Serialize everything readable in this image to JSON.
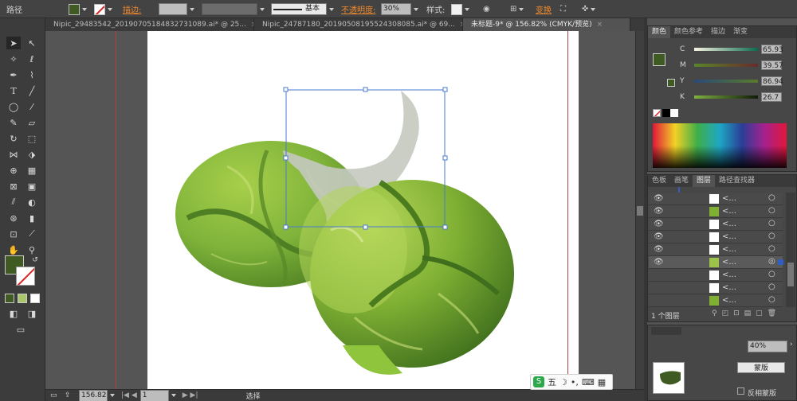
{
  "control_bar": {
    "mode_label": "路径",
    "stroke_label": "描边:",
    "stroke_style": "基本",
    "opacity_label": "不透明度:",
    "opacity_value": "30%",
    "style_label": "样式:",
    "transform_label": "变换"
  },
  "tabs": [
    {
      "label": "Nipic_29483542_20190705184832731089.ai* @ 25...",
      "active": false
    },
    {
      "label": "Nipic_24787180_20190508195524308085.ai* @ 69...",
      "active": false
    },
    {
      "label": "未标题-9* @ 156.82% (CMYK/预览)",
      "active": true
    }
  ],
  "color_panel": {
    "tabs": [
      "颜色",
      "颜色参考",
      "描边",
      "渐变"
    ],
    "channels": [
      {
        "name": "C",
        "value": "65.93"
      },
      {
        "name": "M",
        "value": "39.57"
      },
      {
        "name": "Y",
        "value": "86.94"
      },
      {
        "name": "K",
        "value": "26.7"
      }
    ]
  },
  "layers_panel": {
    "tabs": [
      "色板",
      "画笔",
      "图层",
      "路径查找器"
    ],
    "row_label": "<...",
    "footer": "1 个图层"
  },
  "transparency_panel": {
    "opacity_value": "40%",
    "mask_label": "蒙版",
    "invert_label": "反相蒙版"
  },
  "status": {
    "zoom": "156.82",
    "page": "1",
    "tool": "选择"
  },
  "ime": {
    "label": "五"
  },
  "colors": {
    "fill": "#3f5a22",
    "accent": "#f08a2c",
    "guide": "#b34040"
  }
}
